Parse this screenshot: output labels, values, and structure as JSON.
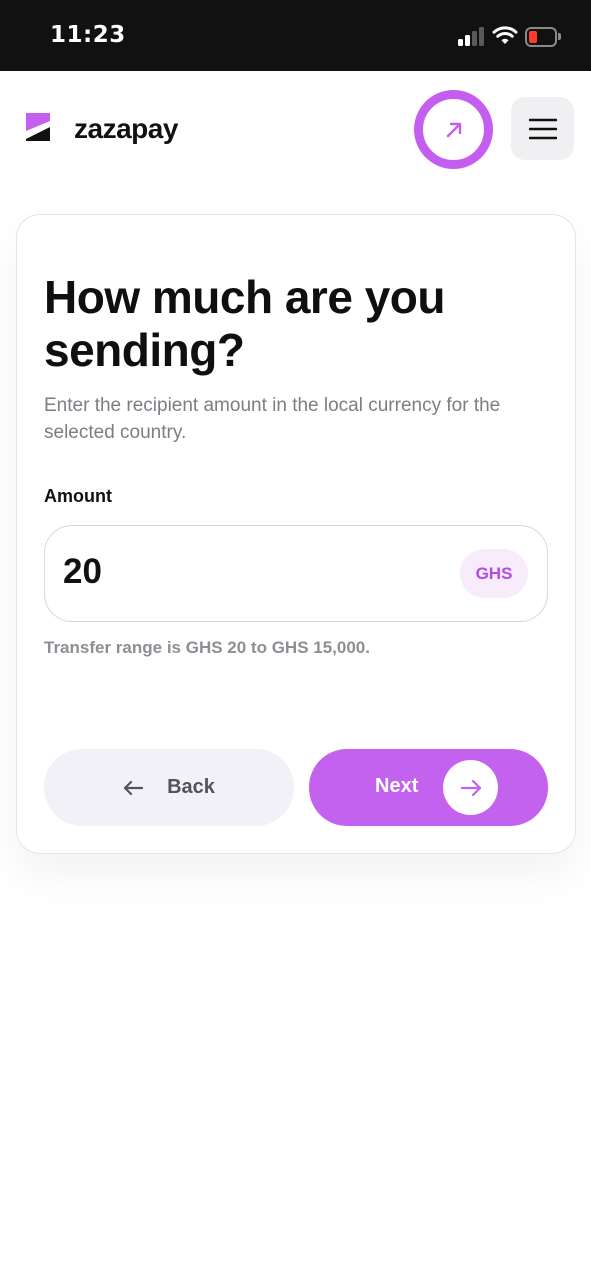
{
  "status_bar": {
    "time": "11:23",
    "battery_level": 0.15
  },
  "header": {
    "brand": "zazapay",
    "send_icon": "arrow-up-right-icon",
    "menu_icon": "hamburger-menu-icon",
    "accent_color": "#c55df0"
  },
  "form": {
    "title": "How much are you sending?",
    "subtitle": "Enter the recipient amount in the local currency for the selected country.",
    "amount_label": "Amount",
    "amount_value": "20",
    "currency": "GHS",
    "range_note": "Transfer range is GHS 20 to GHS 15,000."
  },
  "actions": {
    "back_label": "Back",
    "next_label": "Next",
    "back_icon": "arrow-left-icon",
    "next_icon": "arrow-right-icon"
  }
}
